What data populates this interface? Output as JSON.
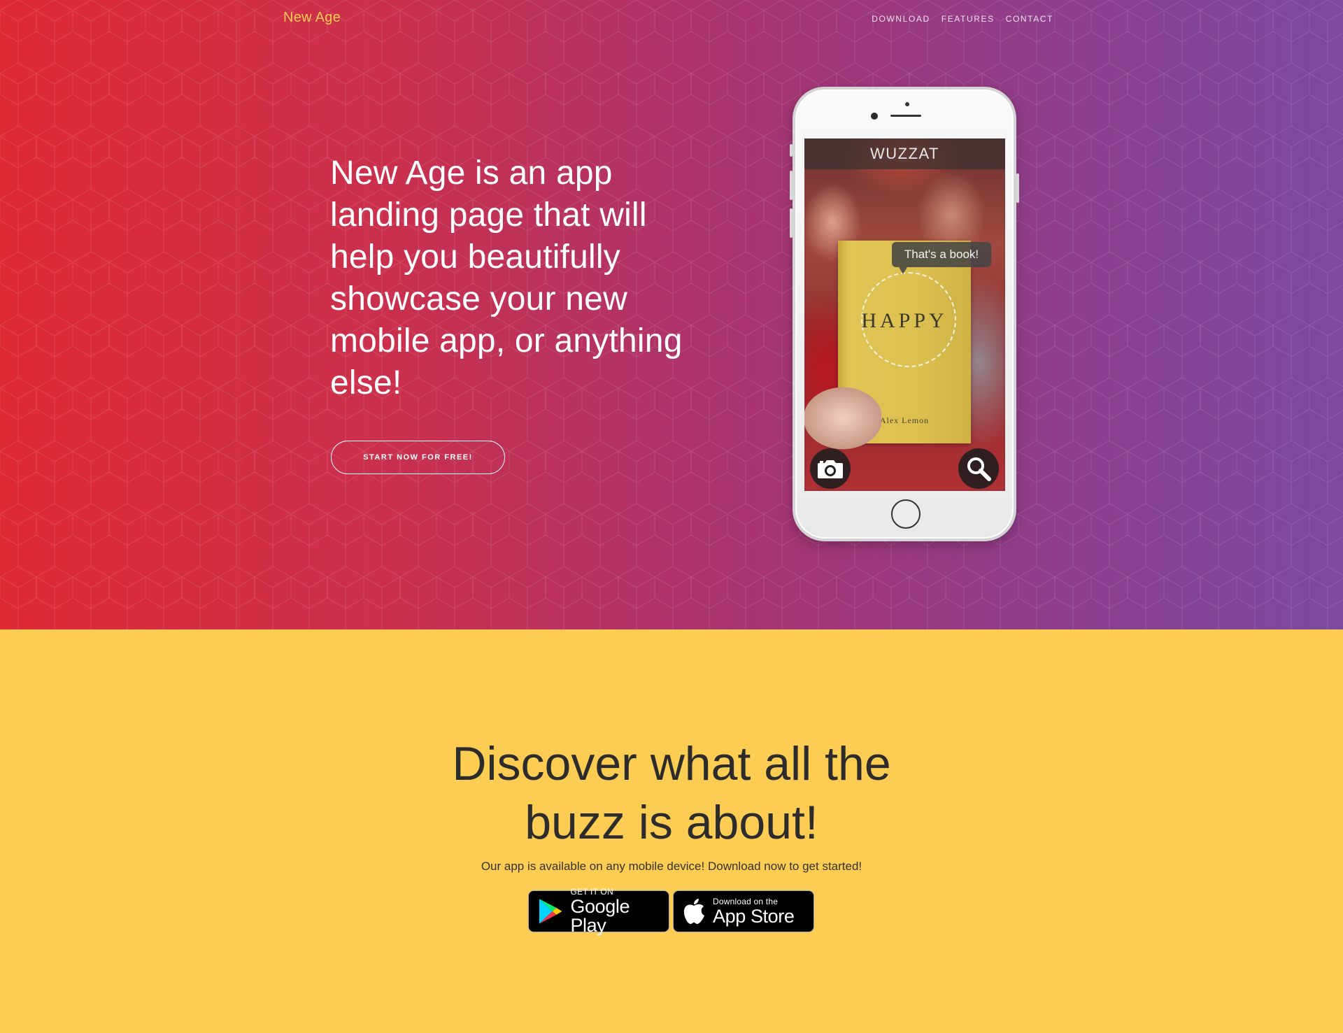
{
  "nav": {
    "brand": "New Age",
    "links": [
      "Download",
      "Features",
      "Contact"
    ]
  },
  "hero": {
    "headline": "New Age is an app landing page that will help you beautifully showcase your new mobile app, or anything else!",
    "cta_label": "START NOW FOR FREE!"
  },
  "phone_screen": {
    "app_name": "WUZZAT",
    "bubble_text": "That's a book!",
    "book_title": "HAPPY",
    "book_author": "Alex Lemon",
    "left_button_icon": "camera-icon",
    "right_button_icon": "search-icon"
  },
  "download": {
    "heading": "Discover what all the buzz is about!",
    "subtext": "Our app is available on any mobile device! Download now to get started!",
    "google_play": {
      "small": "GET IT ON",
      "big": "Google Play"
    },
    "app_store": {
      "small": "Download on the",
      "big": "App Store"
    }
  },
  "colors": {
    "brand": "#fdcc52",
    "hero_gradient_start": "#de2a35",
    "hero_gradient_end": "#7b4a9e",
    "download_bg": "#fdcc52"
  }
}
